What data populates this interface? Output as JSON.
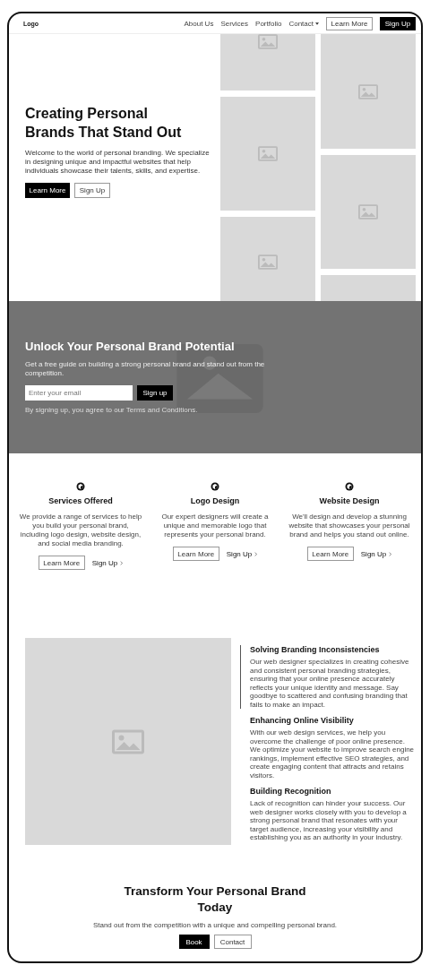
{
  "nav": {
    "logo": "Logo",
    "links": [
      {
        "label": "About Us",
        "kind": "link"
      },
      {
        "label": "Services",
        "kind": "link"
      },
      {
        "label": "Portfolio",
        "kind": "link"
      },
      {
        "label": "Contact",
        "kind": "dropdown"
      }
    ],
    "buttons": [
      {
        "label": "Learn More",
        "kind": "outline"
      },
      {
        "label": "Sign Up",
        "kind": "solid"
      }
    ]
  },
  "hero": {
    "title": "Creating Personal Brands That Stand Out",
    "text": "Welcome to the world of personal branding. We specialize in designing unique and impactful websites that help individuals showcase their talents, skills, and expertise.",
    "buttons": [
      {
        "label": "Learn More",
        "kind": "solid"
      },
      {
        "label": "Sign Up",
        "kind": "outline"
      }
    ]
  },
  "signup": {
    "title": "Unlock Your Personal Brand Potential",
    "text": "Get a free guide on building a strong personal brand and stand out from the competition.",
    "email": {
      "placeholder": "Enter your email"
    },
    "button": "Sign up",
    "note": "By signing up, you agree to our Terms and Conditions."
  },
  "services": [
    {
      "title": "Services Offered",
      "text": "We provide a range of services to help you build your personal brand, including logo design, website design, and social media branding.",
      "button": "Learn More",
      "link": "Sign Up"
    },
    {
      "title": "Logo Design",
      "text": "Our expert designers will create a unique and memorable logo that represents your personal brand.",
      "button": "Learn More",
      "link": "Sign Up"
    },
    {
      "title": "Website Design",
      "text": "We'll design and develop a stunning website that showcases your personal brand and helps you stand out online.",
      "button": "Learn More",
      "link": "Sign Up"
    }
  ],
  "features": [
    {
      "title": "Solving Branding Inconsistencies",
      "text": "Our web designer specializes in creating cohesive and consistent personal branding strategies, ensuring that your online presence accurately reflects your unique identity and message. Say goodbye to scattered and confusing branding that fails to make an impact.",
      "selected": true
    },
    {
      "title": "Enhancing Online Visibility",
      "text": "With our web design services, we help you overcome the challenge of poor online presence. We optimize your website to improve search engine rankings, implement effective SEO strategies, and create engaging content that attracts and retains visitors.",
      "selected": false
    },
    {
      "title": "Building Recognition",
      "text": "Lack of recognition can hinder your success. Our web designer works closely with you to develop a strong personal brand that resonates with your target audience, increasing your visibility and establishing you as an authority in your industry.",
      "selected": false
    }
  ],
  "cta": {
    "title": "Transform Your Personal Brand Today",
    "text": "Stand out from the competition with a unique and compelling personal brand.",
    "buttons": [
      {
        "label": "Book",
        "kind": "solid"
      },
      {
        "label": "Contact",
        "kind": "outline"
      }
    ]
  }
}
